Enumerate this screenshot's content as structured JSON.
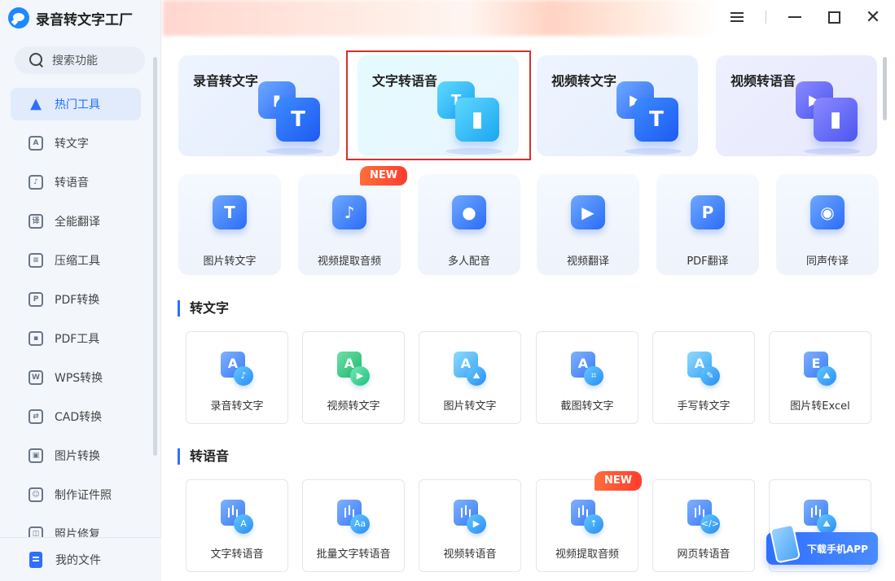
{
  "app": {
    "title": "录音转文字工厂"
  },
  "search": {
    "label": "搜索功能"
  },
  "sidebar": {
    "items": [
      {
        "label": "热门工具",
        "icon": "fire-icon",
        "glyph": "🔥",
        "active": true
      },
      {
        "label": "转文字",
        "icon": "to-text-icon",
        "glyph": "A"
      },
      {
        "label": "转语音",
        "icon": "to-voice-icon",
        "glyph": "♪"
      },
      {
        "label": "全能翻译",
        "icon": "translate-icon",
        "glyph": "译"
      },
      {
        "label": "压缩工具",
        "icon": "compress-icon",
        "glyph": "≡"
      },
      {
        "label": "PDF转换",
        "icon": "pdf-convert-icon",
        "glyph": "P"
      },
      {
        "label": "PDF工具",
        "icon": "pdf-tools-icon",
        "glyph": "▪"
      },
      {
        "label": "WPS转换",
        "icon": "wps-icon",
        "glyph": "W"
      },
      {
        "label": "CAD转换",
        "icon": "cad-icon",
        "glyph": "⇄"
      },
      {
        "label": "图片转换",
        "icon": "image-convert-icon",
        "glyph": "▣"
      },
      {
        "label": "制作证件照",
        "icon": "id-photo-icon",
        "glyph": "☺"
      },
      {
        "label": "照片修复",
        "icon": "photo-repair-icon",
        "glyph": "◫"
      }
    ],
    "my_files": "我的文件"
  },
  "hero": [
    {
      "title": "录音转文字",
      "back": "▮",
      "front": "T",
      "theme": "blue"
    },
    {
      "title": "文字转语音",
      "back": "T",
      "front": "▮",
      "theme": "cyan"
    },
    {
      "title": "视频转文字",
      "back": "▶",
      "front": "T",
      "theme": "blue"
    },
    {
      "title": "视频转语音",
      "back": "▶",
      "front": "▮",
      "theme": "purple"
    }
  ],
  "tools": [
    {
      "label": "图片转文字",
      "icon": "image-to-text-icon"
    },
    {
      "label": "视频提取音频",
      "icon": "music-note-icon",
      "badge": "NEW"
    },
    {
      "label": "多人配音",
      "icon": "people-icon"
    },
    {
      "label": "视频翻译",
      "icon": "video-camera-icon"
    },
    {
      "label": "PDF翻译",
      "icon": "pdf-icon"
    },
    {
      "label": "同声传译",
      "icon": "head-voice-icon"
    }
  ],
  "sections": {
    "to_text": {
      "title": "转文字",
      "items": [
        {
          "label": "录音转文字",
          "a": "A",
          "b": "♪"
        },
        {
          "label": "视频转文字",
          "a": "A",
          "b": "▶",
          "theme": "green"
        },
        {
          "label": "图片转文字",
          "a": "A",
          "b": "⛰",
          "theme": "lb"
        },
        {
          "label": "截图转文字",
          "a": "A",
          "b": "⌗"
        },
        {
          "label": "手写转文字",
          "a": "A",
          "b": "✎",
          "theme": "lb"
        },
        {
          "label": "图片转Excel",
          "a": "E",
          "b": "⛰"
        }
      ]
    },
    "to_voice": {
      "title": "转语音",
      "items": [
        {
          "label": "文字转语音",
          "b": "A"
        },
        {
          "label": "批量文字转语音",
          "b": "Aa"
        },
        {
          "label": "视频转语音",
          "b": "▶"
        },
        {
          "label": "视频提取音频",
          "b": "↑",
          "badge": "NEW"
        },
        {
          "label": "网页转语音",
          "b": "</>"
        },
        {
          "label": "",
          "b": "⛰"
        }
      ]
    }
  },
  "download": {
    "label": "下载手机APP"
  }
}
